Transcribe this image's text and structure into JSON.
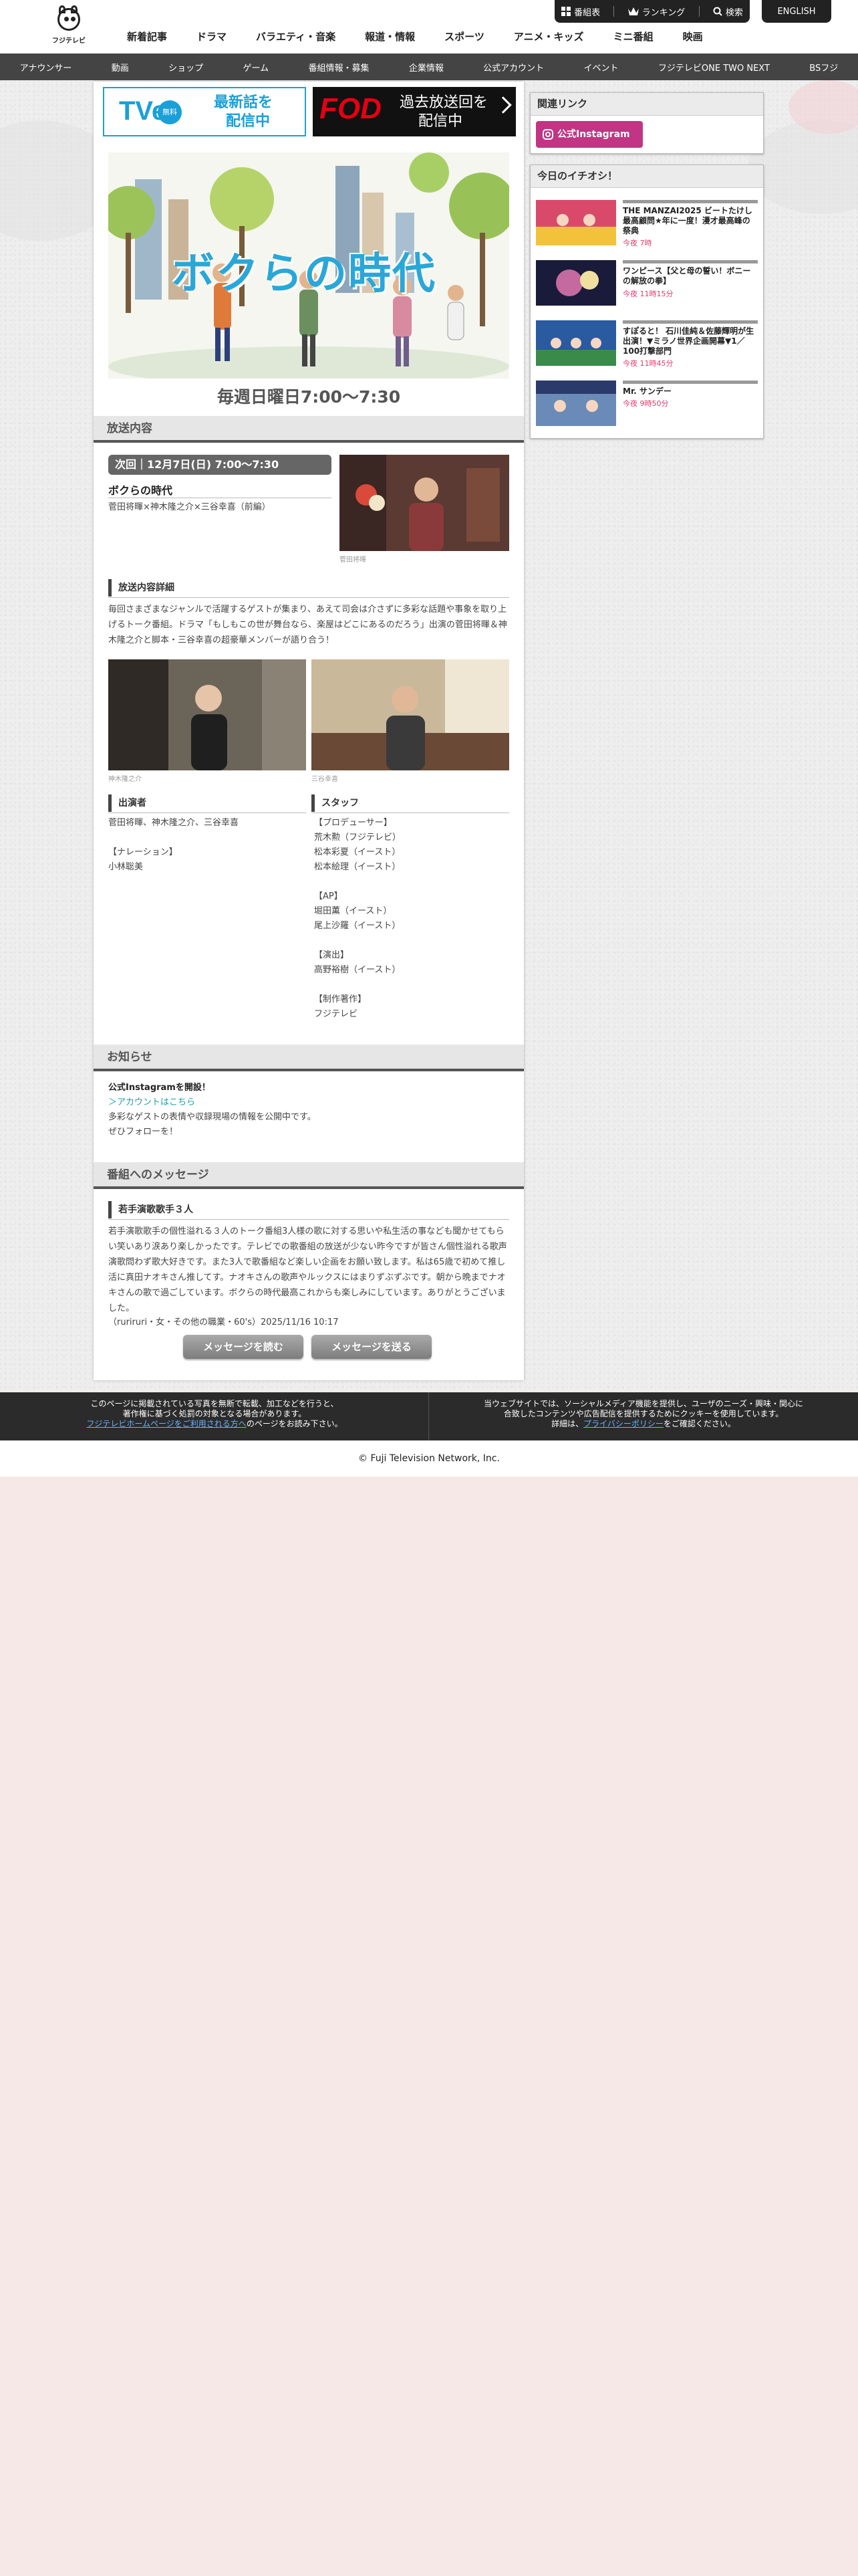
{
  "header": {
    "logo_text": "フジテレビ",
    "util": {
      "schedule": "番組表",
      "ranking": "ランキング",
      "search": "検索"
    },
    "english": "ENGLISH",
    "main_nav": [
      "新着記事",
      "ドラマ",
      "バラエティ・音楽",
      "報道・情報",
      "スポーツ",
      "アニメ・キッズ",
      "ミニ番組",
      "映画"
    ],
    "sub_nav": [
      "アナウンサー",
      "動画",
      "ショップ",
      "ゲーム",
      "番組情報・募集",
      "企業情報",
      "公式アカウント",
      "イベント",
      "フジテレビONE TWO NEXT",
      "BSフジ"
    ]
  },
  "banners": {
    "tver_logo": "TVer",
    "tver_badge": "無料",
    "tver_text_1": "最新話を",
    "tver_text_2": "配信中",
    "fod_logo": "FOD",
    "fod_text_1": "過去放送回を",
    "fod_text_2": "配信中"
  },
  "program": {
    "keyart_title": "ボクらの時代",
    "airtime": "毎週日曜日7:00〜7:30"
  },
  "broadcast": {
    "heading": "放送内容",
    "next_label": "次回｜12月7日(日) 7:00〜7:30",
    "title": "ボクらの時代",
    "guests": "菅田将暉×神木隆之介×三谷幸喜（前編）",
    "main_photo_caption": "菅田将暉",
    "detail_heading": "放送内容詳細",
    "detail_text": "毎回さまざまなジャンルで活躍するゲストが集まり、あえて司会は介さずに多彩な話題や事象を取り上げるトーク番組。ドラマ「もしもこの世が舞台なら、楽屋はどこにあるのだろう」出演の菅田将暉＆神木隆之介と脚本・三谷幸喜の超豪華メンバーが語り合う！",
    "photo_captions": [
      "神木隆之介",
      "三谷幸喜"
    ]
  },
  "cast": {
    "heading": "出演者",
    "lines": [
      "菅田将暉、神木隆之介、三谷幸喜",
      "",
      "【ナレーション】",
      "小林聡美"
    ]
  },
  "staff": {
    "heading": "スタッフ",
    "lines": [
      "【プロデューサー】",
      "荒木勲（フジテレビ）",
      "松本彩夏（イースト）",
      "松本絵理（イースト）",
      "",
      "【AP】",
      "堀田薫（イースト）",
      "尾上沙羅（イースト）",
      "",
      "【演出】",
      "高野裕樹（イースト）",
      "",
      "【制作著作】",
      "フジテレビ"
    ]
  },
  "news": {
    "heading": "お知らせ",
    "title": "公式Instagramを開設！",
    "link": "＞アカウントはこちら",
    "body_1": "多彩なゲストの表情や収録現場の情報を公開中です。",
    "body_2": "ぜひフォローを！"
  },
  "messages": {
    "heading": "番組へのメッセージ",
    "subheading": "若手演歌歌手３人",
    "body": "若手演歌歌手の個性溢れる３人のトーク番組3人様の歌に対する思いや私生活の事なども聞かせてもらい笑いあり涙あり楽しかったです。テレビでの歌番組の放送が少ない昨今ですが皆さん個性溢れる歌声演歌問わず歌大好きです。また3人で歌番組など楽しい企画をお願い致します。私は65歳で初めて推し活に真田ナオキさん推してす。ナオキさんの歌声やルックスにはまりずぶずぶです。朝から晩までナオキさんの歌で過ごしています。ボクらの時代最高これからも楽しみにしています。ありがとうございました。",
    "meta": "（ruriruri・女・その他の職業・60's）2025/11/16 10:17",
    "read_button": "メッセージを読む",
    "send_button": "メッセージを送る"
  },
  "sidebar": {
    "links_heading": "関連リンク",
    "instagram_label": "公式Instagram",
    "picks_heading": "今日のイチオシ！",
    "picks": [
      {
        "title": "THE MANZAI2025 ビートたけし最高顧問★年に一度！漫才最高峰の祭典",
        "time": "今夜 7時"
      },
      {
        "title": "ワンピース【父と母の誓い！ボニーの解放の拳】",
        "time": "今夜 11時15分"
      },
      {
        "title": "すぽると！ 石川佳純＆佐藤輝明が生出演！▼ミラノ世界企画開幕▼1／100打撃部門",
        "time": "今夜 11時45分"
      },
      {
        "title": "Mr. サンデー",
        "time": "今夜 9時50分"
      }
    ]
  },
  "footer": {
    "left_1": "このページに掲載されている写真を無断で転載、加工などを行うと、",
    "left_2": "著作権に基づく処罰の対象となる場合があります。",
    "left_link": "フジテレビホームページをご利用される方へ",
    "left_3": "のページをお読み下さい。",
    "right_1": "当ウェブサイトでは、ソーシャルメディア機能を提供し、ユーザのニーズ・興味・関心に",
    "right_2": "合致したコンテンツや広告配信を提供するためにクッキーを使用しています。",
    "right_3a": "詳細は、",
    "right_link": "プライバシーポリシー",
    "right_3b": "をご確認ください。",
    "copyright": "© Fuji Television Network, Inc."
  },
  "colors": {
    "accent_blue": "#1aa0d8",
    "fod_red": "#e50012",
    "instagram": "#c13584",
    "time_pink": "#e23b6a",
    "page_bg": "#f6e8e6"
  }
}
